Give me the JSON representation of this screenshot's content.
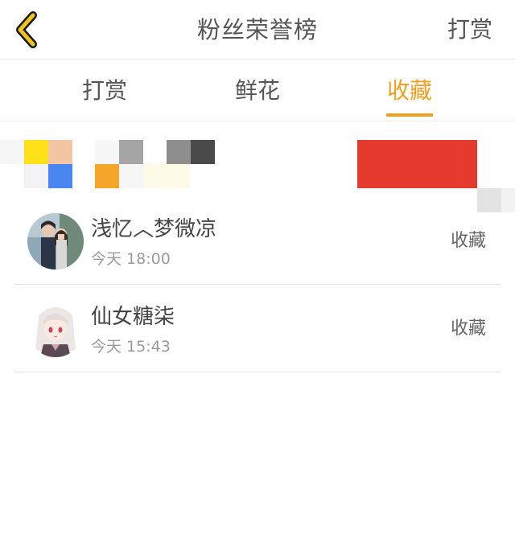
{
  "header": {
    "title": "粉丝荣誉榜",
    "action_label": "打赏",
    "back_icon": "chevron-left-icon",
    "accent_color": "#f0c41c"
  },
  "tabs": [
    {
      "label": "打赏",
      "active": false
    },
    {
      "label": "鲜花",
      "active": false
    },
    {
      "label": "收藏",
      "active": true
    }
  ],
  "accent_color": "#f0a020",
  "list": [
    {
      "name": "浅忆︿梦微凉",
      "time": "今天 18:00",
      "action": "收藏",
      "avatar": "couple-photo"
    },
    {
      "name": "仙女糖柒",
      "time": "今天 15:43",
      "action": "收藏",
      "avatar": "anime-girl"
    }
  ]
}
